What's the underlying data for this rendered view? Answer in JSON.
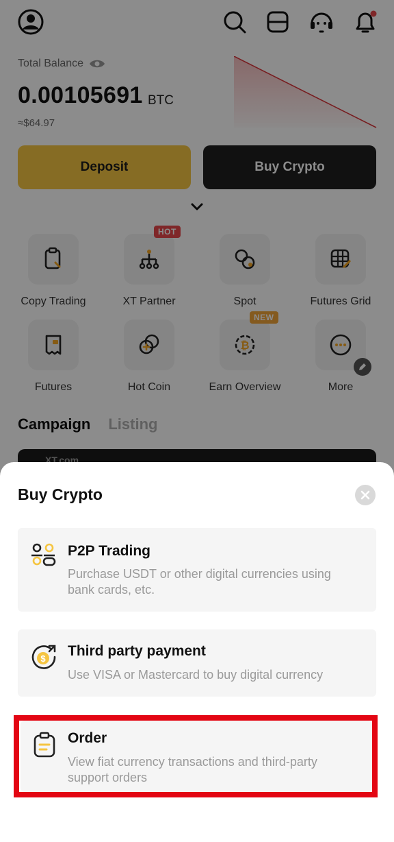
{
  "header": {
    "icons": [
      "profile-icon",
      "search-icon",
      "scan-icon",
      "support-icon",
      "bell-icon"
    ]
  },
  "balance": {
    "label": "Total Balance",
    "value": "0.00105691",
    "unit": "BTC",
    "fiat": "≈$64.97"
  },
  "actions": {
    "deposit_label": "Deposit",
    "buy_label": "Buy Crypto"
  },
  "shortcuts": [
    {
      "label": "Copy Trading",
      "icon": "copy-trading-icon"
    },
    {
      "label": "XT Partner",
      "icon": "partner-icon",
      "badge": "HOT"
    },
    {
      "label": "Spot",
      "icon": "spot-icon"
    },
    {
      "label": "Futures Grid",
      "icon": "futures-grid-icon"
    },
    {
      "label": "Futures",
      "icon": "futures-icon"
    },
    {
      "label": "Hot Coin",
      "icon": "hot-coin-icon"
    },
    {
      "label": "Earn Overview",
      "icon": "earn-icon",
      "badge": "NEW"
    },
    {
      "label": "More",
      "icon": "more-icon"
    }
  ],
  "tabs": {
    "campaign": "Campaign",
    "listing": "Listing"
  },
  "banner": {
    "logo_text": "XT.com"
  },
  "sheet": {
    "title": "Buy Crypto",
    "options": [
      {
        "title": "P2P Trading",
        "description": "Purchase USDT or other digital currencies using bank cards, etc.",
        "icon": "p2p-icon"
      },
      {
        "title": "Third party payment",
        "description": "Use VISA or Mastercard to buy digital currency",
        "icon": "third-party-payment-icon"
      },
      {
        "title": "Order",
        "description": "View fiat currency transactions and third-party support orders",
        "icon": "order-icon",
        "highlighted": true
      }
    ]
  },
  "colors": {
    "accent_yellow": "#f5c542",
    "dark_button": "#1f1f1f",
    "hot_badge": "#e8474b",
    "new_badge": "#f0a43a",
    "highlight_border": "#e30613",
    "option_icon_accent": "#f5c542"
  }
}
